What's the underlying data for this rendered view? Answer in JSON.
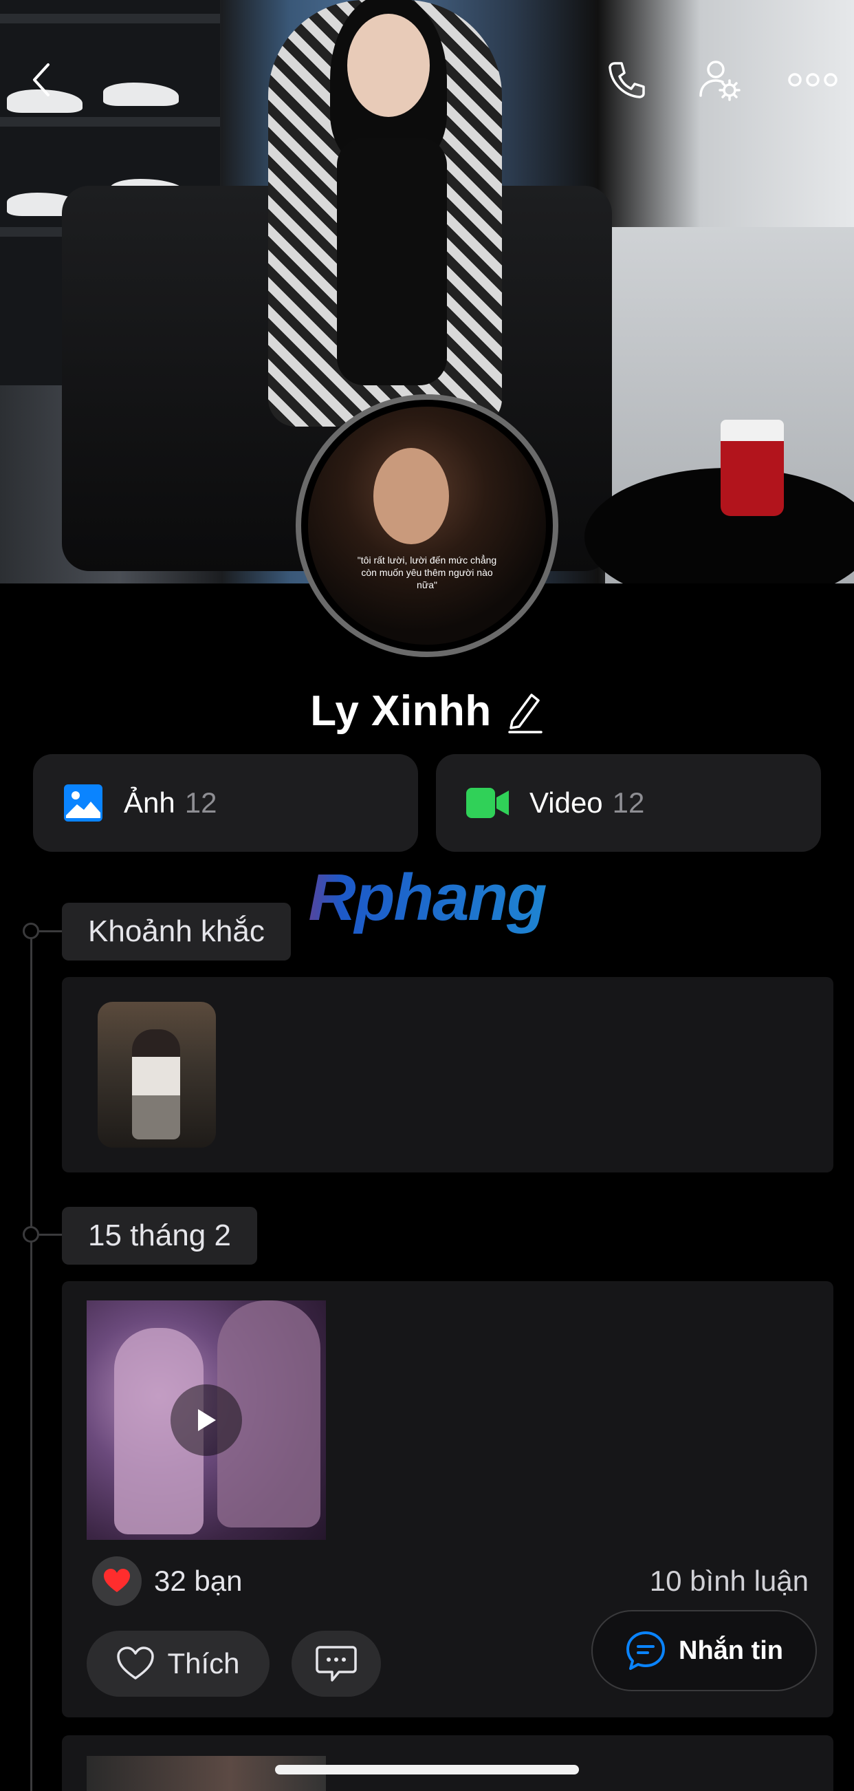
{
  "header": {
    "back_icon": "chevron-left-icon",
    "call_icon": "phone-icon",
    "settings_icon": "user-gear-icon",
    "more_icon": "more-horizontal-icon"
  },
  "avatar": {
    "quote": "\"tôi rất lười, lười đến mức chẳng còn muốn yêu thêm người nào nữa\""
  },
  "profile": {
    "name": "Ly Xinhh",
    "edit_icon": "pencil-icon"
  },
  "media": {
    "photos": {
      "label": "Ảnh",
      "count": "12",
      "icon": "image-icon",
      "color": "#0a84ff"
    },
    "videos": {
      "label": "Video",
      "count": "12",
      "icon": "video-camera-icon",
      "color": "#30d158"
    }
  },
  "watermark": "Rphang",
  "timeline": {
    "moments": {
      "title": "Khoảnh khắc"
    },
    "post_date": {
      "title": "15 tháng 2"
    }
  },
  "post": {
    "reaction_count": "32 bạn",
    "reaction_icon": "heart-icon",
    "comments": "10 bình luận",
    "like_label": "Thích",
    "comment_icon": "chat-bubble-icon"
  },
  "message_button": {
    "label": "Nhắn tin",
    "icon": "message-icon",
    "color": "#0a84ff"
  }
}
